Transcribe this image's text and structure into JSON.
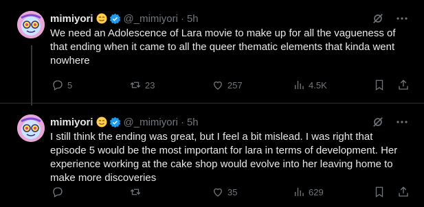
{
  "tweets": [
    {
      "name": "mimiyori",
      "handle": "@_mimiyori",
      "sep": "·",
      "time": "5h",
      "text": "We need an Adolescence of Lara movie to make up for all the vagueness of that ending when it came to all the queer thematic elements that kinda went nowhere",
      "replies": "5",
      "reposts": "23",
      "likes": "257",
      "views": "4.5K"
    },
    {
      "name": "mimiyori",
      "handle": "@_mimiyori",
      "sep": "·",
      "time": "5h",
      "text": "I still think the ending was great, but I feel a bit mislead. I was right that episode 5 would be the most important for lara in terms of development. Her experience working at the cake shop would evolve into her leaving home to make more discoveries",
      "replies": "",
      "reposts": "",
      "likes": "35",
      "views": "629"
    }
  ],
  "colors": {
    "background": "#000000",
    "text": "#e7e9ea",
    "muted": "#71767b",
    "verified": "#1d9bf0",
    "divider": "#2f3336"
  },
  "icons": [
    "smiley-emoji-icon",
    "verified-badge-icon",
    "grok-icon",
    "more-icon",
    "reply-icon",
    "repost-icon",
    "like-icon",
    "views-icon",
    "bookmark-icon",
    "share-icon"
  ]
}
